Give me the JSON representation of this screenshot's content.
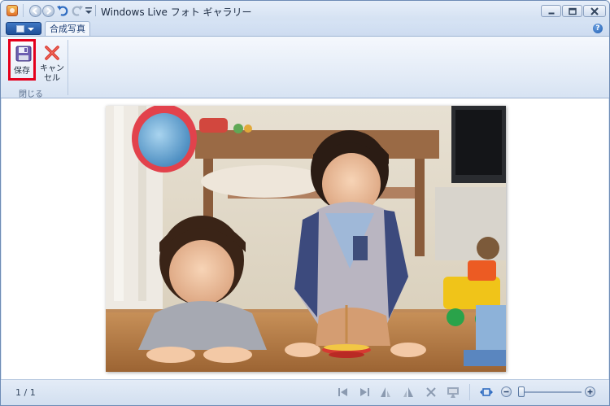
{
  "window": {
    "title": "Windows Live フォト ギャラリー"
  },
  "ribbon": {
    "active_tab": "合成写真",
    "save_label": "保存",
    "cancel_label_line1": "キャン",
    "cancel_label_line2": "セル",
    "group_label": "閉じる"
  },
  "statusbar": {
    "page_count": "1 / 1",
    "zoom_level": 0.05
  },
  "colors": {
    "highlight": "#e4001c",
    "accent": "#1f4f98"
  },
  "icons": [
    "app-icon",
    "back-icon",
    "forward-icon",
    "undo-icon",
    "redo-icon",
    "customize-dropdown-icon",
    "minimize-icon",
    "maximize-icon",
    "close-icon",
    "help-icon",
    "save-icon",
    "cancel-icon",
    "previous-icon",
    "next-icon",
    "rotate-left-icon",
    "rotate-right-icon",
    "delete-icon",
    "slideshow-icon",
    "fit-to-window-icon",
    "zoom-out-icon",
    "zoom-in-icon"
  ]
}
